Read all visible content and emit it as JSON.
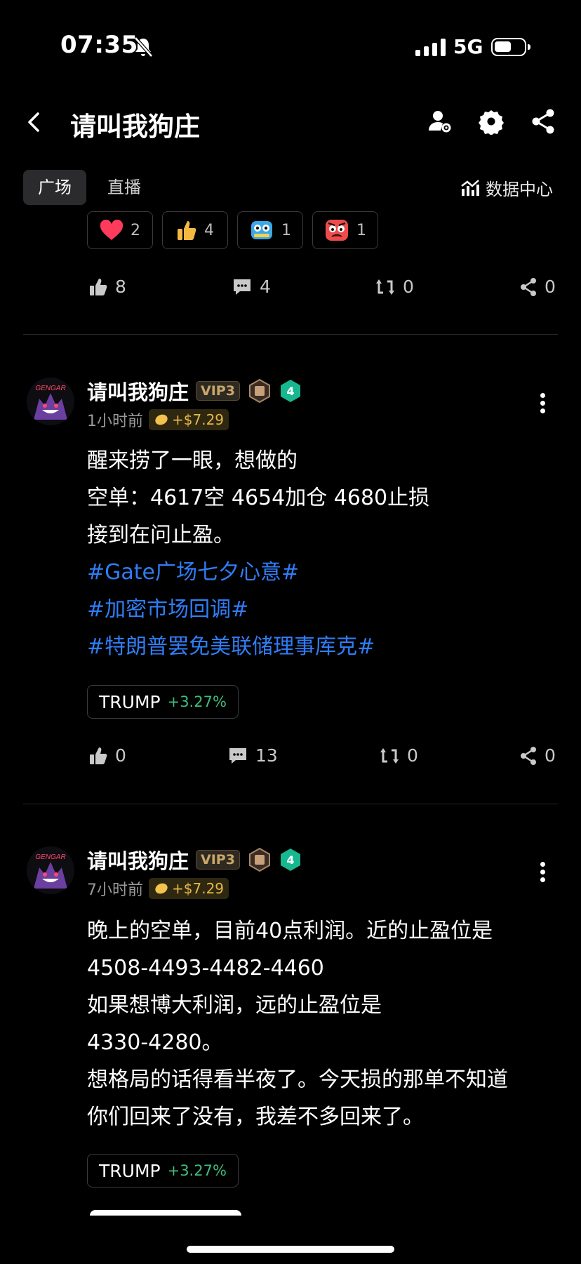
{
  "status": {
    "time": "07:35",
    "network": "5G"
  },
  "header": {
    "title": "请叫我狗庄"
  },
  "tabs": [
    {
      "label": "广场"
    },
    {
      "label": "直播"
    }
  ],
  "data_center": "数据中心",
  "reactions": [
    {
      "icon": "heart-emoji",
      "count": "2"
    },
    {
      "icon": "thumbs-up-emoji",
      "count": "4"
    },
    {
      "icon": "robot-emoji",
      "count": "1"
    },
    {
      "icon": "angry-face-emoji",
      "count": "1"
    }
  ],
  "top_actions": {
    "likes": "8",
    "comments": "4",
    "reposts": "0",
    "shares": "0"
  },
  "posts": [
    {
      "username": "请叫我狗庄",
      "vip": "VIP3",
      "level": "4",
      "time": "1小时前",
      "reward": "+$7.29",
      "lines": [
        "醒来捞了一眼，想做的",
        "空单：4617空 4654加仓 4680止损",
        "接到在问止盈。"
      ],
      "tags": [
        "#Gate广场七夕心意#",
        "#加密市场回调#",
        "#特朗普罢免美联储理事库克#"
      ],
      "ticker": {
        "symbol": "TRUMP",
        "change": "+3.27%"
      },
      "actions": {
        "likes": "0",
        "comments": "13",
        "reposts": "0",
        "shares": "0"
      }
    },
    {
      "username": "请叫我狗庄",
      "vip": "VIP3",
      "level": "4",
      "time": "7小时前",
      "reward": "+$7.29",
      "lines": [
        "晚上的空单，目前40点利润。近的止盈位是",
        "4508-4493-4482-4460",
        "如果想博大利润，远的止盈位是",
        "4330-4280。",
        "想格局的话得看半夜了。今天损的那单不知道",
        "你们回来了没有，我差不多回来了。"
      ],
      "ticker": {
        "symbol": "TRUMP",
        "change": "+3.27%"
      }
    }
  ]
}
